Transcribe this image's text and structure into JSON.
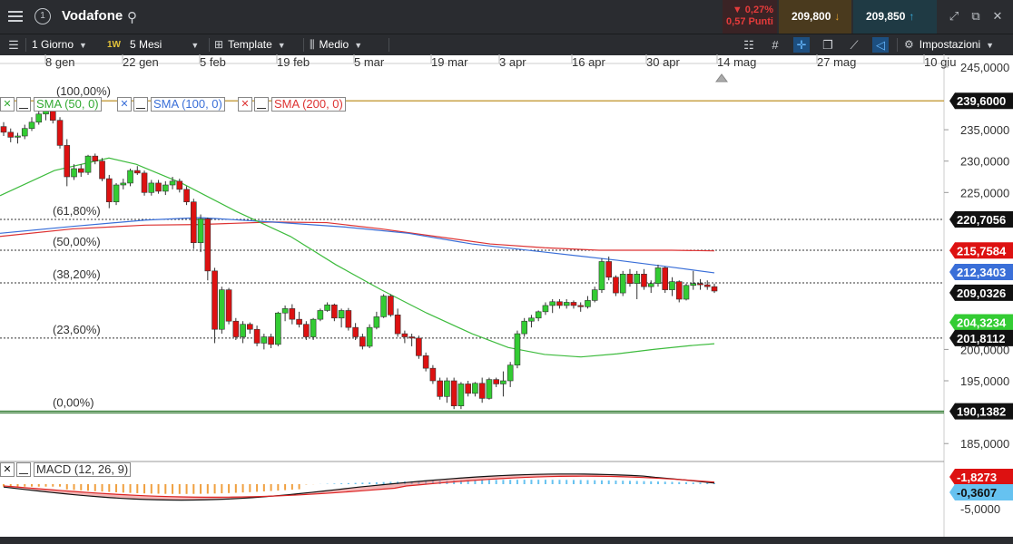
{
  "header": {
    "instrument": "Vodafone",
    "change_pct": "▼ 0,27%",
    "change_pts": "0,57 Punti",
    "bid": "209,800",
    "ask": "209,850"
  },
  "toolbar": {
    "interval": "1 Giorno",
    "period_short": "1W",
    "period": "5 Mesi",
    "template": "Template",
    "indicator": "Medio",
    "settings": "Impostazioni"
  },
  "legend": {
    "sma50": "SMA (50, 0)",
    "sma100": "SMA (100, 0)",
    "sma200": "SMA (200, 0)",
    "macd": "MACD (12, 26, 9)"
  },
  "colors": {
    "up": "#33cc33",
    "down": "#dd1111",
    "sma50": "#3dbb3d",
    "sma100": "#3a6fd8",
    "sma200": "#dd3333",
    "bg_dark": "#2a2c30",
    "price_label": "#111111",
    "bid_bg": "#4a3a1e",
    "ask_bg": "#1f3a44"
  },
  "chart_data": {
    "type": "candlestick",
    "x_labels": [
      "8 gen",
      "22 gen",
      "5 feb",
      "19 feb",
      "5 mar",
      "19 mar",
      "3 apr",
      "16 apr",
      "30 apr",
      "14 mag",
      "27 mag",
      "10 giu"
    ],
    "y_ticks": [
      "245,0000",
      "235,0000",
      "230,0000",
      "225,0000",
      "200,0000",
      "195,0000",
      "185,0000"
    ],
    "ylim": [
      182,
      247
    ],
    "fib_levels": [
      {
        "label": "(100,00%)",
        "value": 239.6
      },
      {
        "label": "(61,80%)",
        "value": 220.7056
      },
      {
        "label": "(50,00%)",
        "value": 215.8
      },
      {
        "label": "(38,20%)",
        "value": 210.6
      },
      {
        "label": "(23,60%)",
        "value": 201.8112
      },
      {
        "label": "(0,00%)",
        "value": 190.1382
      }
    ],
    "price_labels": [
      {
        "text": "239,6000",
        "value": 239.6,
        "style": "dark"
      },
      {
        "text": "220,7056",
        "value": 220.7056,
        "style": "dark"
      },
      {
        "text": "215,7584",
        "value": 215.7584,
        "style": "red"
      },
      {
        "text": "212,3403",
        "value": 212.3403,
        "style": "blue"
      },
      {
        "text": "209,0326",
        "value": 209.0326,
        "style": "dark"
      },
      {
        "text": "204,3234",
        "value": 204.3234,
        "style": "green"
      },
      {
        "text": "201,8112",
        "value": 201.8112,
        "style": "dark"
      },
      {
        "text": "190,1382",
        "value": 190.1382,
        "style": "dark"
      }
    ],
    "candles": [
      [
        235.5,
        236.2,
        234.0,
        234.6
      ],
      [
        234.6,
        235.2,
        233.0,
        233.8
      ],
      [
        233.8,
        234.5,
        232.8,
        234.0
      ],
      [
        234.0,
        235.8,
        233.5,
        235.2
      ],
      [
        235.2,
        237.0,
        234.8,
        236.2
      ],
      [
        236.2,
        238.0,
        235.8,
        237.5
      ],
      [
        237.5,
        239.6,
        236.5,
        238.3
      ],
      [
        238.3,
        239.2,
        236.0,
        236.5
      ],
      [
        236.5,
        237.0,
        232.0,
        232.5
      ],
      [
        232.5,
        233.5,
        226.0,
        227.5
      ],
      [
        227.5,
        229.5,
        227.0,
        228.8
      ],
      [
        228.8,
        229.5,
        227.5,
        228.2
      ],
      [
        228.2,
        231.0,
        227.8,
        230.8
      ],
      [
        230.8,
        231.2,
        229.5,
        230.0
      ],
      [
        230.0,
        230.5,
        226.8,
        227.2
      ],
      [
        227.2,
        227.8,
        222.5,
        223.5
      ],
      [
        223.5,
        226.5,
        223.0,
        226.2
      ],
      [
        226.2,
        227.2,
        225.5,
        226.5
      ],
      [
        226.5,
        228.8,
        226.0,
        228.5
      ],
      [
        228.5,
        229.2,
        227.8,
        228.1
      ],
      [
        228.1,
        228.5,
        224.5,
        225.0
      ],
      [
        225.0,
        227.0,
        224.5,
        226.5
      ],
      [
        226.5,
        227.0,
        224.8,
        225.2
      ],
      [
        225.2,
        226.8,
        224.6,
        226.2
      ],
      [
        226.2,
        227.5,
        225.5,
        226.8
      ],
      [
        226.8,
        227.2,
        225.0,
        225.5
      ],
      [
        225.5,
        226.0,
        223.0,
        223.5
      ],
      [
        223.5,
        224.0,
        216.0,
        217.0
      ],
      [
        217.0,
        221.5,
        215.5,
        220.8
      ],
      [
        220.8,
        221.0,
        211.0,
        212.5
      ],
      [
        212.5,
        213.0,
        201.0,
        203.2
      ],
      [
        203.2,
        210.0,
        202.5,
        209.5
      ],
      [
        209.5,
        209.8,
        204.0,
        204.5
      ],
      [
        204.5,
        205.0,
        201.5,
        202.0
      ],
      [
        202.0,
        204.5,
        201.0,
        204.0
      ],
      [
        204.0,
        204.3,
        202.5,
        203.2
      ],
      [
        203.2,
        203.8,
        200.5,
        201.0
      ],
      [
        201.0,
        202.5,
        200.0,
        202.0
      ],
      [
        202.0,
        202.5,
        200.2,
        200.8
      ],
      [
        200.8,
        206.0,
        200.5,
        205.8
      ],
      [
        205.8,
        207.0,
        204.5,
        206.5
      ],
      [
        206.5,
        207.2,
        204.0,
        204.8
      ],
      [
        204.8,
        206.0,
        203.5,
        204.0
      ],
      [
        204.0,
        204.5,
        201.5,
        202.0
      ],
      [
        202.0,
        205.0,
        201.5,
        204.8
      ],
      [
        204.8,
        206.5,
        204.5,
        206.2
      ],
      [
        206.2,
        207.5,
        206.0,
        207.1
      ],
      [
        207.1,
        207.3,
        204.5,
        205.0
      ],
      [
        205.0,
        206.5,
        203.5,
        206.2
      ],
      [
        206.2,
        206.6,
        203.0,
        203.5
      ],
      [
        203.5,
        204.2,
        201.5,
        202.0
      ],
      [
        202.0,
        202.5,
        200.0,
        200.5
      ],
      [
        200.5,
        204.0,
        200.2,
        203.5
      ],
      [
        203.5,
        206.0,
        203.2,
        205.2
      ],
      [
        205.2,
        208.8,
        205.0,
        208.5
      ],
      [
        208.5,
        208.8,
        205.2,
        205.5
      ],
      [
        205.5,
        206.5,
        202.0,
        202.5
      ],
      [
        202.5,
        203.0,
        201.0,
        202.0
      ],
      [
        202.0,
        202.5,
        200.5,
        201.8
      ],
      [
        201.8,
        202.2,
        198.5,
        199.0
      ],
      [
        199.0,
        199.5,
        196.5,
        197.0
      ],
      [
        197.0,
        197.5,
        194.5,
        195.0
      ],
      [
        195.0,
        195.5,
        192.0,
        192.5
      ],
      [
        192.5,
        195.5,
        191.5,
        195.0
      ],
      [
        195.0,
        195.5,
        190.5,
        191.0
      ],
      [
        191.0,
        194.8,
        190.5,
        194.5
      ],
      [
        194.5,
        195.0,
        192.5,
        193.0
      ],
      [
        193.0,
        194.8,
        192.5,
        194.6
      ],
      [
        194.6,
        195.5,
        191.5,
        192.2
      ],
      [
        192.2,
        195.5,
        192.0,
        195.2
      ],
      [
        195.2,
        195.5,
        194.0,
        194.5
      ],
      [
        194.5,
        196.5,
        192.5,
        195.0
      ],
      [
        195.0,
        198.0,
        194.0,
        197.5
      ],
      [
        197.5,
        203.0,
        197.0,
        202.5
      ],
      [
        202.5,
        205.0,
        202.0,
        204.5
      ],
      [
        204.5,
        205.5,
        203.5,
        205.0
      ],
      [
        205.0,
        206.2,
        204.5,
        206.0
      ],
      [
        206.0,
        207.5,
        205.5,
        207.0
      ],
      [
        207.0,
        208.0,
        205.8,
        207.6
      ],
      [
        207.6,
        208.0,
        206.5,
        207.0
      ],
      [
        207.0,
        208.0,
        206.5,
        207.5
      ],
      [
        207.5,
        207.8,
        206.5,
        207.0
      ],
      [
        207.0,
        207.5,
        206.0,
        206.8
      ],
      [
        206.8,
        208.5,
        206.5,
        207.8
      ],
      [
        207.8,
        210.0,
        207.5,
        209.5
      ],
      [
        209.5,
        214.5,
        209.0,
        214.0
      ],
      [
        214.0,
        214.8,
        211.0,
        211.5
      ],
      [
        211.5,
        211.8,
        208.5,
        209.0
      ],
      [
        209.0,
        212.5,
        208.5,
        212.0
      ],
      [
        212.0,
        212.8,
        210.0,
        210.5
      ],
      [
        210.5,
        212.5,
        208.0,
        212.0
      ],
      [
        212.0,
        212.8,
        209.5,
        210.0
      ],
      [
        210.0,
        211.0,
        209.0,
        210.5
      ],
      [
        210.5,
        213.5,
        210.0,
        213.0
      ],
      [
        213.0,
        213.2,
        209.0,
        209.5
      ],
      [
        209.5,
        211.5,
        208.5,
        210.8
      ],
      [
        210.8,
        211.0,
        207.5,
        208.0
      ],
      [
        208.0,
        210.5,
        207.8,
        210.2
      ],
      [
        210.2,
        212.5,
        209.5,
        210.5
      ],
      [
        210.5,
        211.2,
        209.5,
        210.3
      ],
      [
        210.3,
        211.0,
        209.5,
        210.0
      ],
      [
        210.0,
        210.5,
        209.0,
        209.3
      ]
    ],
    "sma50": [
      [
        0,
        224.5
      ],
      [
        60,
        228.5
      ],
      [
        120,
        230.5
      ],
      [
        150,
        229.5
      ],
      [
        200,
        226.5
      ],
      [
        260,
        222.0
      ],
      [
        320,
        218.0
      ],
      [
        370,
        213.5
      ],
      [
        420,
        209.5
      ],
      [
        470,
        205.8
      ],
      [
        520,
        202.5
      ],
      [
        560,
        200.3
      ],
      [
        600,
        199.2
      ],
      [
        640,
        198.8
      ],
      [
        680,
        199.3
      ],
      [
        720,
        200.0
      ],
      [
        760,
        200.6
      ],
      [
        787,
        200.9
      ]
    ],
    "sma100": [
      [
        0,
        218.5
      ],
      [
        80,
        219.6
      ],
      [
        160,
        220.6
      ],
      [
        220,
        221.0
      ],
      [
        300,
        220.3
      ],
      [
        380,
        219.5
      ],
      [
        450,
        218.5
      ],
      [
        520,
        216.8
      ],
      [
        600,
        215.5
      ],
      [
        680,
        214.2
      ],
      [
        740,
        213.1
      ],
      [
        787,
        212.2
      ]
    ],
    "sma200": [
      [
        0,
        218.0
      ],
      [
        80,
        219.2
      ],
      [
        160,
        219.8
      ],
      [
        220,
        219.9
      ],
      [
        300,
        220.3
      ],
      [
        360,
        220.2
      ],
      [
        420,
        219.2
      ],
      [
        480,
        218.0
      ],
      [
        540,
        216.8
      ],
      [
        600,
        216.2
      ],
      [
        660,
        215.8
      ],
      [
        740,
        215.8
      ],
      [
        787,
        215.7
      ]
    ]
  },
  "macd_data": {
    "label_top": "-1,8273",
    "label_bottom": "-0,3607",
    "label_axis": "-5,0000"
  }
}
